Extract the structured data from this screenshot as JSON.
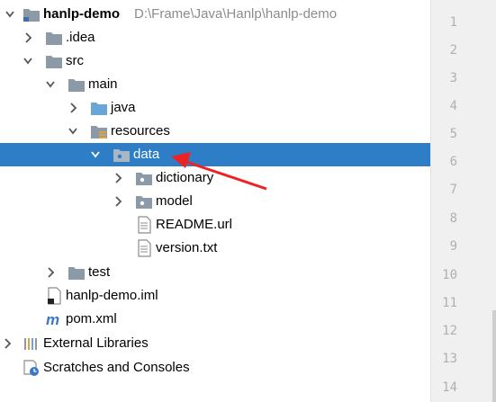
{
  "tree": {
    "project_name": "hanlp-demo",
    "project_path": "D:\\Frame\\Java\\Hanlp\\hanlp-demo",
    "items": [
      {
        "label": "hanlp-demo",
        "icon": "project-folder-icon"
      },
      {
        "label": ".idea",
        "icon": "folder-icon"
      },
      {
        "label": "src",
        "icon": "folder-icon"
      },
      {
        "label": "main",
        "icon": "folder-icon"
      },
      {
        "label": "java",
        "icon": "source-folder-icon"
      },
      {
        "label": "resources",
        "icon": "resources-folder-icon"
      },
      {
        "label": "data",
        "icon": "package-folder-icon"
      },
      {
        "label": "dictionary",
        "icon": "package-folder-icon"
      },
      {
        "label": "model",
        "icon": "package-folder-icon"
      },
      {
        "label": "README.url",
        "icon": "file-icon"
      },
      {
        "label": "version.txt",
        "icon": "text-file-icon"
      },
      {
        "label": "test",
        "icon": "folder-icon"
      },
      {
        "label": "hanlp-demo.iml",
        "icon": "iml-file-icon"
      },
      {
        "label": "pom.xml",
        "icon": "maven-icon"
      },
      {
        "label": "External Libraries",
        "icon": "libraries-icon"
      },
      {
        "label": "Scratches and Consoles",
        "icon": "scratches-icon"
      }
    ],
    "selected": "data"
  },
  "gutter": {
    "line_numbers": [
      "1",
      "2",
      "3",
      "4",
      "5",
      "6",
      "7",
      "8",
      "9",
      "10",
      "11",
      "12",
      "13",
      "14"
    ]
  },
  "colors": {
    "selection": "#2d7ec6",
    "folder": "#8c99a6",
    "source_folder": "#6aa5d8",
    "annotation_arrow": "#ee2222"
  }
}
